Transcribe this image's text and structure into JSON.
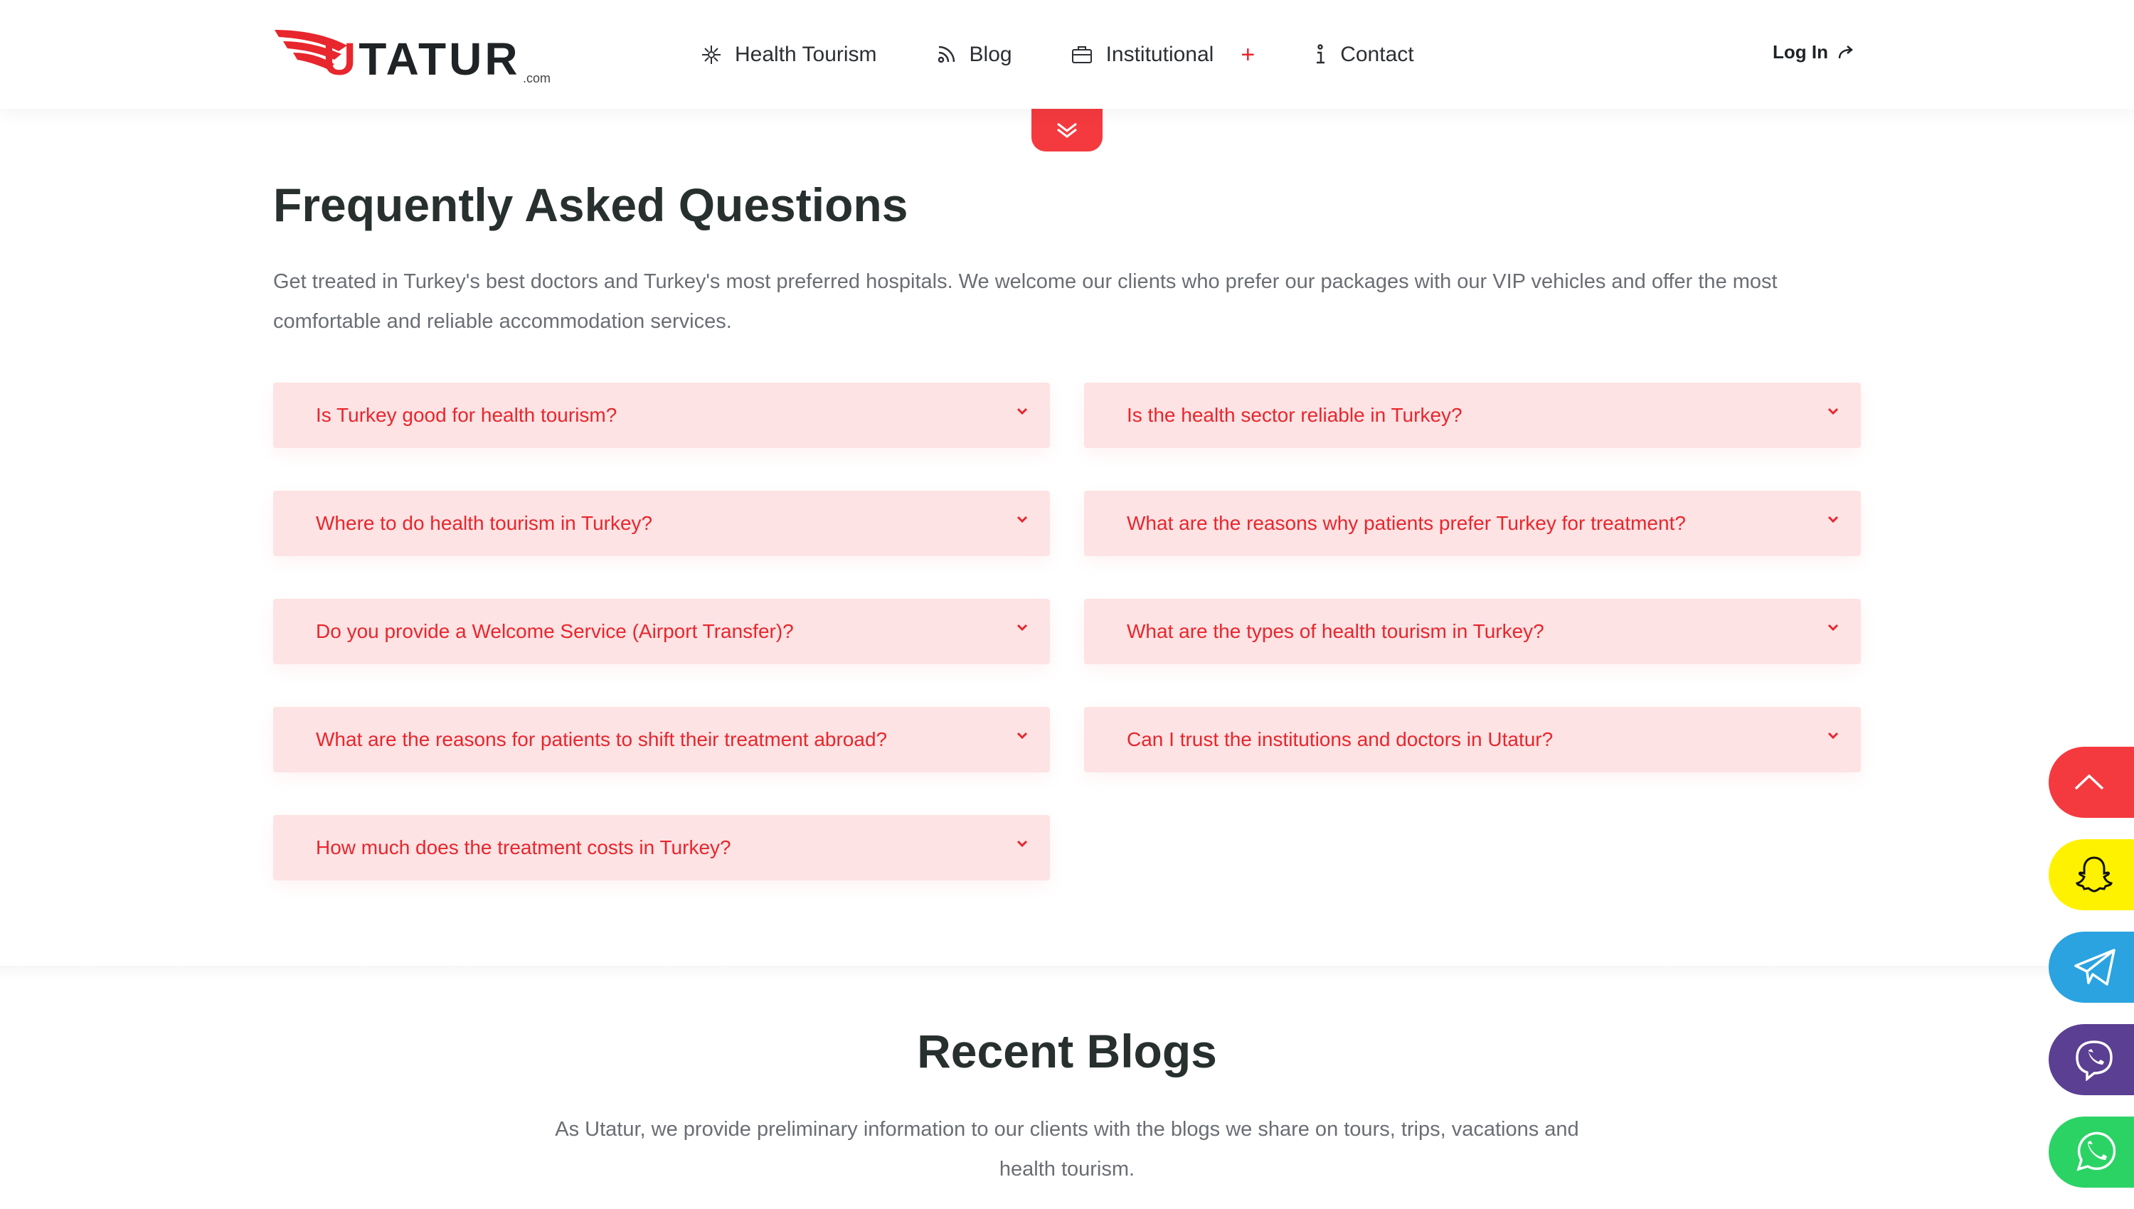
{
  "header": {
    "logo": {
      "brand": "UTATUR",
      "suffix": ".com"
    },
    "nav": [
      {
        "label": "Health Tourism",
        "icon": "health-icon"
      },
      {
        "label": "Blog",
        "icon": "blog-icon"
      },
      {
        "label": "Institutional",
        "icon": "briefcase-icon",
        "expand": "+"
      },
      {
        "label": "Contact",
        "icon": "info-icon"
      }
    ],
    "login": {
      "label": "Log In",
      "icon": "login-arrow-icon"
    }
  },
  "faq": {
    "title": "Frequently Asked Questions",
    "intro": "Get treated in Turkey's best doctors and Turkey's most preferred hospitals. We welcome our clients who prefer our packages with our VIP vehicles and offer the most comfortable and reliable accommodation services.",
    "items": [
      {
        "question": "Is Turkey good for health tourism?"
      },
      {
        "question": "Is the health sector reliable in Turkey?"
      },
      {
        "question": "Where to do health tourism in Turkey?"
      },
      {
        "question": "What are the reasons why patients prefer Turkey for treatment?"
      },
      {
        "question": "Do you provide a Welcome Service (Airport Transfer)?"
      },
      {
        "question": "What are the types of health tourism in Turkey?"
      },
      {
        "question": "What are the reasons for patients to shift their treatment abroad?"
      },
      {
        "question": "Can I trust the institutions and doctors in Utatur?"
      },
      {
        "question": "How much does the treatment costs in Turkey?"
      }
    ]
  },
  "blogs": {
    "title": "Recent Blogs",
    "intro": "As Utatur, we provide preliminary information to our clients with the blogs we share on tours, trips, vacations and health tourism."
  },
  "floating": [
    "scroll-top-icon",
    "snapchat-icon",
    "telegram-icon",
    "viber-icon",
    "whatsapp-icon"
  ],
  "colors": {
    "accent": "#e8262d",
    "faq_bg": "#fde3e4",
    "snapchat": "#fff200",
    "telegram": "#2aa3e0",
    "viber": "#5b3f92",
    "whatsapp": "#2bd365"
  }
}
